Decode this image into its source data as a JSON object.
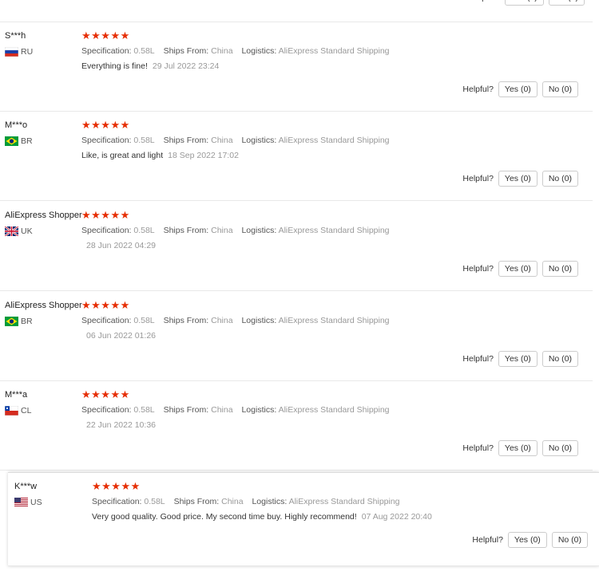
{
  "helpful_label": "Helpful?",
  "yes_label": "Yes (0)",
  "no_label": "No (0)",
  "spec_label": "Specification:",
  "ships_label": "Ships From:",
  "logistics_label": "Logistics:",
  "star_color": "#e62e04",
  "rating": 5,
  "reviews": [
    {
      "name": "S***h",
      "country": "RU",
      "stars": "★★★★★",
      "spec": "0.58L",
      "ships_from": "China",
      "logistics": "AliExpress Standard Shipping",
      "text": "Everything is fine!",
      "date": "29 Jul 2022 23:24"
    },
    {
      "name": "M***o",
      "country": "BR",
      "stars": "★★★★★",
      "spec": "0.58L",
      "ships_from": "China",
      "logistics": "AliExpress Standard Shipping",
      "text": "Like, is great and light",
      "date": "18 Sep 2022 17:02"
    },
    {
      "name": "AliExpress Shopper",
      "country": "UK",
      "stars": "★★★★★",
      "spec": "0.58L",
      "ships_from": "China",
      "logistics": "AliExpress Standard Shipping",
      "text": "",
      "date": "28 Jun 2022 04:29"
    },
    {
      "name": "AliExpress Shopper",
      "country": "BR",
      "stars": "★★★★★",
      "spec": "0.58L",
      "ships_from": "China",
      "logistics": "AliExpress Standard Shipping",
      "text": "",
      "date": "06 Jun 2022 01:26"
    },
    {
      "name": "M***a",
      "country": "CL",
      "stars": "★★★★★",
      "spec": "0.58L",
      "ships_from": "China",
      "logistics": "AliExpress Standard Shipping",
      "text": "",
      "date": "22 Jun 2022 10:36"
    },
    {
      "name": "K***w",
      "country": "US",
      "stars": "★★★★★",
      "spec": "0.58L",
      "ships_from": "China",
      "logistics": "AliExpress Standard Shipping",
      "text": "Very good quality. Good price. My second time buy. Highly recommend!",
      "date": "07 Aug 2022 20:40"
    }
  ]
}
